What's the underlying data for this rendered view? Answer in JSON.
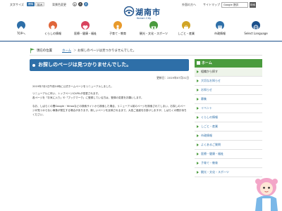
{
  "topbar": {
    "font_size_label": "文字サイズ",
    "standard_label": "標準",
    "enlarge_label": "拡大",
    "bg_color_label": "背景色変更",
    "chip_a_label": "あ",
    "foreign_label": "外国の方へ",
    "sitemap_label": "サイトマップ",
    "search_placeholder": "Google 提供",
    "search_button": "検索"
  },
  "logo": {
    "title": "湖南市",
    "subtitle": "Konan City"
  },
  "gnav": [
    {
      "label": "TOPへ",
      "color": "#2e6fa8"
    },
    {
      "label": "くらしの情報",
      "color": "#e0663a"
    },
    {
      "label": "医療・健康・福祉",
      "color": "#d9435e"
    },
    {
      "label": "子育て・教育",
      "color": "#e89a2c"
    },
    {
      "label": "観光・文化・スポーツ",
      "color": "#4a9b3d"
    },
    {
      "label": "しごと・産業",
      "color": "#d1a526"
    },
    {
      "label": "市政情報",
      "color": "#2e6fa8"
    },
    {
      "label": "Select Language",
      "color": "#1a4f8a"
    }
  ],
  "breadcrumb": {
    "label": "現在の位置",
    "home": "ホーム",
    "separator": "＞",
    "current": "お探しのページは見つかりませんでした。"
  },
  "main": {
    "title": "お探しのページは見つかりませんでした。",
    "updated": "更新日：2019年07月01日",
    "para1": "2019年7月1日午前10時に公式ホームページをリニューアルしました。",
    "para2": "リニューアルに伴い、トップページのURLが変更されます。\n各ページを「お気に入り」や「ブックマーク」に登録している方は、登録の変更をお願いします。",
    "para3": "なお、しばらくの間Google・Yahooなどの検索サイトから検索した場合、リニューアル前のページを検索されてしまい、お探しのページが見つからない事象が発生する場合があります。新しいページを反映されるまで、大変ご迷惑をお掛けしますが、しばらくの間お待ちください。"
  },
  "sidebar": {
    "heading": "ホーム",
    "items": [
      {
        "label": "組織から探す"
      },
      {
        "label": "大切なお知らせ"
      },
      {
        "label": "お知らせ"
      },
      {
        "label": "募集"
      },
      {
        "label": "イベント"
      },
      {
        "label": "くらしの情報"
      },
      {
        "label": "しごと・産業"
      },
      {
        "label": "市政情報"
      },
      {
        "label": "よくあるご質問"
      },
      {
        "label": "医療・健康・福祉"
      },
      {
        "label": "子育て・教育"
      },
      {
        "label": "観光・文化・スポーツ"
      }
    ]
  },
  "colors": {
    "brand_blue": "#2e6fa8",
    "dark_blue": "#1a4f8a",
    "side_green": "#4a9b3d"
  }
}
